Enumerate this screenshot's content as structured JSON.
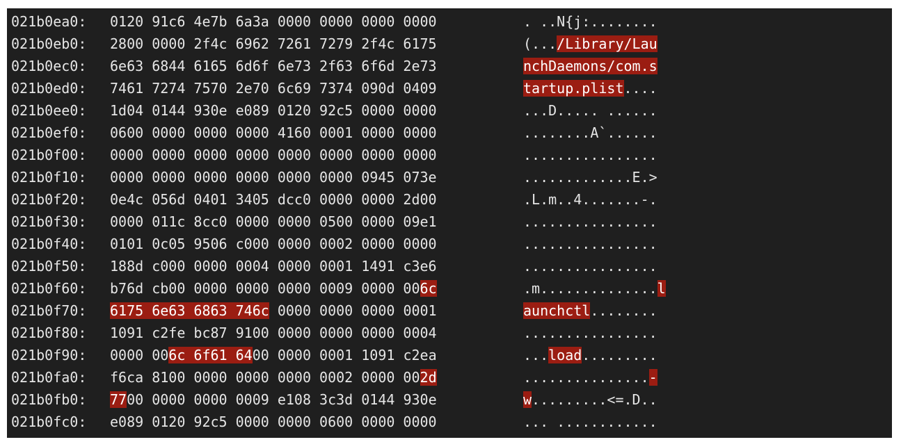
{
  "hexdump": {
    "rows": [
      {
        "addr": "021b0ea0:",
        "hex": [
          {
            "t": "0120 91c6 4e7b 6a3a 0000 0000 0000 0000",
            "h": false
          }
        ],
        "ascii": [
          {
            "t": ". ..N{j:........",
            "h": false
          }
        ]
      },
      {
        "addr": "021b0eb0:",
        "hex": [
          {
            "t": "2800 0000 2f4c 6962 7261 7279 2f4c 6175",
            "h": false
          }
        ],
        "ascii": [
          {
            "t": "(...",
            "h": false
          },
          {
            "t": "/Library/Lau",
            "h": true
          }
        ]
      },
      {
        "addr": "021b0ec0:",
        "hex": [
          {
            "t": "6e63 6844 6165 6d6f 6e73 2f63 6f6d 2e73",
            "h": false
          }
        ],
        "ascii": [
          {
            "t": "nchDaemons/com.s",
            "h": true
          }
        ]
      },
      {
        "addr": "021b0ed0:",
        "hex": [
          {
            "t": "7461 7274 7570 2e70 6c69 7374 090d 0409",
            "h": false
          }
        ],
        "ascii": [
          {
            "t": "tartup.plist",
            "h": true
          },
          {
            "t": "....",
            "h": false
          }
        ]
      },
      {
        "addr": "021b0ee0:",
        "hex": [
          {
            "t": "1d04 0144 930e e089 0120 92c5 0000 0000",
            "h": false
          }
        ],
        "ascii": [
          {
            "t": "...D..... ......",
            "h": false
          }
        ]
      },
      {
        "addr": "021b0ef0:",
        "hex": [
          {
            "t": "0600 0000 0000 0000 4160 0001 0000 0000",
            "h": false
          }
        ],
        "ascii": [
          {
            "t": "........A`......",
            "h": false
          }
        ]
      },
      {
        "addr": "021b0f00:",
        "hex": [
          {
            "t": "0000 0000 0000 0000 0000 0000 0000 0000",
            "h": false
          }
        ],
        "ascii": [
          {
            "t": "................",
            "h": false
          }
        ]
      },
      {
        "addr": "021b0f10:",
        "hex": [
          {
            "t": "0000 0000 0000 0000 0000 0000 0945 073e",
            "h": false
          }
        ],
        "ascii": [
          {
            "t": ".............E.>",
            "h": false
          }
        ]
      },
      {
        "addr": "021b0f20:",
        "hex": [
          {
            "t": "0e4c 056d 0401 3405 dcc0 0000 0000 2d00",
            "h": false
          }
        ],
        "ascii": [
          {
            "t": ".L.m..4.......-.",
            "h": false
          }
        ]
      },
      {
        "addr": "021b0f30:",
        "hex": [
          {
            "t": "0000 011c 8cc0 0000 0000 0500 0000 09e1",
            "h": false
          }
        ],
        "ascii": [
          {
            "t": "................",
            "h": false
          }
        ]
      },
      {
        "addr": "021b0f40:",
        "hex": [
          {
            "t": "0101 0c05 9506 c000 0000 0002 0000 0000",
            "h": false
          }
        ],
        "ascii": [
          {
            "t": "................",
            "h": false
          }
        ]
      },
      {
        "addr": "021b0f50:",
        "hex": [
          {
            "t": "188d c000 0000 0004 0000 0001 1491 c3e6",
            "h": false
          }
        ],
        "ascii": [
          {
            "t": "................",
            "h": false
          }
        ]
      },
      {
        "addr": "021b0f60:",
        "hex": [
          {
            "t": "b76d cb00 0000 0000 0000 0009 0000 00",
            "h": false
          },
          {
            "t": "6c",
            "h": true
          }
        ],
        "ascii": [
          {
            "t": ".m..............",
            "h": false
          },
          {
            "t": "l",
            "h": true
          }
        ]
      },
      {
        "addr": "021b0f70:",
        "hex": [
          {
            "t": "6175 6e63 6863 746c",
            "h": true
          },
          {
            "t": " 0000 0000 0000 0001",
            "h": false
          }
        ],
        "ascii": [
          {
            "t": "aunchctl",
            "h": true
          },
          {
            "t": "........",
            "h": false
          }
        ]
      },
      {
        "addr": "021b0f80:",
        "hex": [
          {
            "t": "1091 c2fe bc87 9100 0000 0000 0000 0004",
            "h": false
          }
        ],
        "ascii": [
          {
            "t": "................",
            "h": false
          }
        ]
      },
      {
        "addr": "021b0f90:",
        "hex": [
          {
            "t": "0000 00",
            "h": false
          },
          {
            "t": "6c 6f61 64",
            "h": true
          },
          {
            "t": "00 0000 0001 1091 c2ea",
            "h": false
          }
        ],
        "ascii": [
          {
            "t": "...",
            "h": false
          },
          {
            "t": "load",
            "h": true
          },
          {
            "t": ".........",
            "h": false
          }
        ]
      },
      {
        "addr": "021b0fa0:",
        "hex": [
          {
            "t": "f6ca 8100 0000 0000 0000 0002 0000 00",
            "h": false
          },
          {
            "t": "2d",
            "h": true
          }
        ],
        "ascii": [
          {
            "t": "...............",
            "h": false
          },
          {
            "t": "-",
            "h": true
          }
        ]
      },
      {
        "addr": "021b0fb0:",
        "hex": [
          {
            "t": "77",
            "h": true
          },
          {
            "t": "00 0000 0000 0009 e108 3c3d 0144 930e",
            "h": false
          }
        ],
        "ascii": [
          {
            "t": "w",
            "h": true
          },
          {
            "t": ".........<=.D..",
            "h": false
          }
        ]
      },
      {
        "addr": "021b0fc0:",
        "hex": [
          {
            "t": "e089 0120 92c5 0000 0000 0600 0000 0000",
            "h": false
          }
        ],
        "ascii": [
          {
            "t": "... ............",
            "h": false
          }
        ]
      }
    ]
  }
}
